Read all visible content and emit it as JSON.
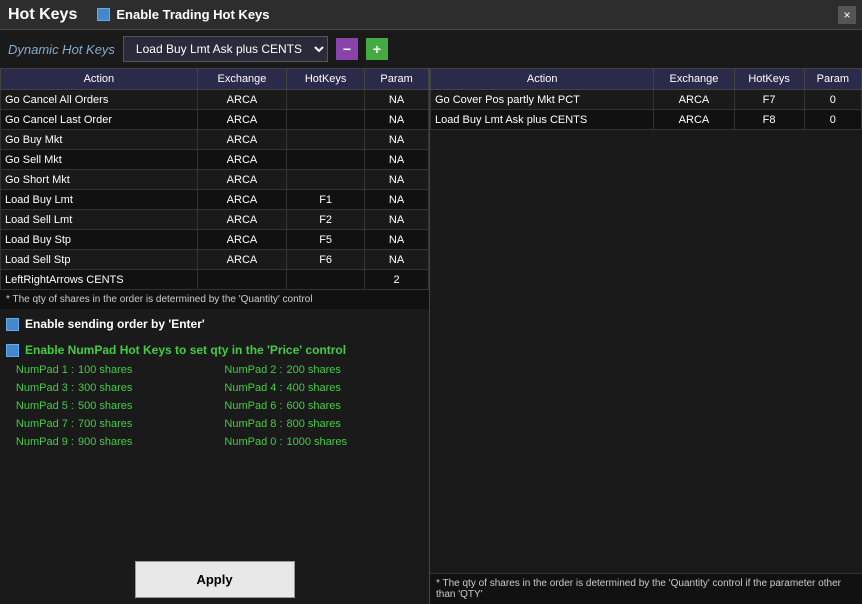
{
  "titleBar": {
    "title": "Hot Keys",
    "enableLabel": "Enable Trading Hot Keys",
    "closeLabel": "×"
  },
  "dynamicBar": {
    "label": "Dynamic Hot Keys",
    "selectValue": "Load Buy Lmt Ask plus CENTS",
    "minusLabel": "−",
    "plusLabel": "+"
  },
  "leftTable": {
    "headers": [
      "Action",
      "Exchange",
      "HotKeys",
      "Param"
    ],
    "rows": [
      {
        "action": "Go Cancel All Orders",
        "exchange": "ARCA",
        "hotkeys": "",
        "param": "NA",
        "color": "white"
      },
      {
        "action": "Go Cancel Last Order",
        "exchange": "ARCA",
        "hotkeys": "",
        "param": "NA",
        "color": "white"
      },
      {
        "action": "Go Buy Mkt",
        "exchange": "ARCA",
        "hotkeys": "",
        "param": "NA",
        "color": "cyan"
      },
      {
        "action": "Go Sell Mkt",
        "exchange": "ARCA",
        "hotkeys": "",
        "param": "NA",
        "color": "cyan"
      },
      {
        "action": "Go Short Mkt",
        "exchange": "ARCA",
        "hotkeys": "",
        "param": "NA",
        "color": "white"
      },
      {
        "action": "Load Buy Lmt",
        "exchange": "ARCA",
        "hotkeys": "F1",
        "param": "NA",
        "color": "cyan"
      },
      {
        "action": "Load Sell Lmt",
        "exchange": "ARCA",
        "hotkeys": "F2",
        "param": "NA",
        "color": "cyan"
      },
      {
        "action": "Load Buy Stp",
        "exchange": "ARCA",
        "hotkeys": "F5",
        "param": "NA",
        "color": "cyan"
      },
      {
        "action": "Load Sell Stp",
        "exchange": "ARCA",
        "hotkeys": "F6",
        "param": "NA",
        "color": "cyan"
      },
      {
        "action": "LeftRightArrows CENTS",
        "exchange": "",
        "hotkeys": "",
        "param": "2",
        "color": "white"
      }
    ]
  },
  "footnote": "* The qty of shares in the order is determined by the 'Quantity' control",
  "enableEnter": {
    "label": "Enable sending order by 'Enter'"
  },
  "numpad": {
    "titleLabel": "Enable NumPad Hot Keys to set qty in the 'Price' control",
    "rows": [
      {
        "key": "NumPad 1 :",
        "value": "100 shares"
      },
      {
        "key": "NumPad 2 :",
        "value": "200 shares"
      },
      {
        "key": "NumPad 3 :",
        "value": "300 shares"
      },
      {
        "key": "NumPad 4 :",
        "value": "400 shares"
      },
      {
        "key": "NumPad 5 :",
        "value": "500 shares"
      },
      {
        "key": "NumPad 6 :",
        "value": "600 shares"
      },
      {
        "key": "NumPad 7 :",
        "value": "700 shares"
      },
      {
        "key": "NumPad 8 :",
        "value": "800 shares"
      },
      {
        "key": "NumPad 9 :",
        "value": "900 shares"
      },
      {
        "key": "NumPad 0 :",
        "value": "1000 shares"
      }
    ]
  },
  "applyBtn": {
    "label": "Apply"
  },
  "rightTable": {
    "headers": [
      "Action",
      "Exchange",
      "HotKeys",
      "Param"
    ],
    "rows": [
      {
        "action": "Go Cover Pos partly Mkt PCT",
        "exchange": "ARCA",
        "hotkeys": "F7",
        "param": "0",
        "color": "white"
      },
      {
        "action": "Load Buy Lmt Ask plus CENTS",
        "exchange": "ARCA",
        "hotkeys": "F8",
        "param": "0",
        "color": "orange"
      }
    ]
  },
  "rightFootnote": "* The qty of shares in the order is determined by the 'Quantity' control if the parameter other than 'QTY'"
}
